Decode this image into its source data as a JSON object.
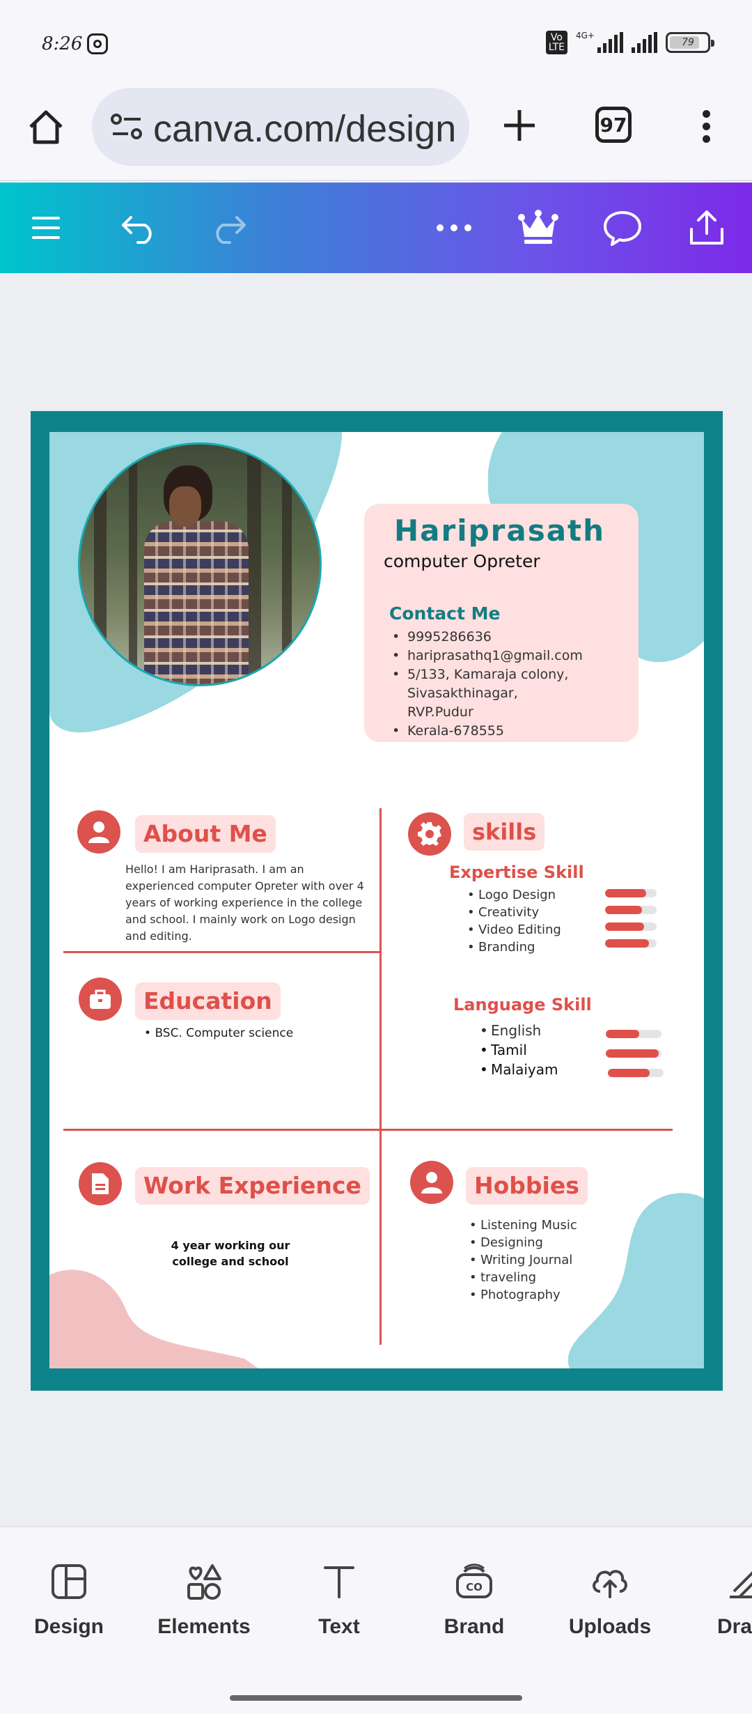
{
  "status_bar": {
    "time": "8:26",
    "volte": "Vo\nLTE",
    "network": "4G+",
    "battery": "79"
  },
  "browser": {
    "url": "canva.com/design",
    "tab_count": "97"
  },
  "resume": {
    "name": "Hariprasath",
    "role": "computer Opreter",
    "contact": {
      "title": "Contact Me",
      "items": [
        "9995286636",
        "hariprasathq1@gmail.com",
        "5/133, Kamaraja colony, Sivasakthinagar, RVP.Pudur",
        "Kerala-678555"
      ]
    },
    "about": {
      "title": "About Me",
      "text": "Hello! I am Hariprasath. I am an experienced computer Opreter with over 4 years of working experience in the college and school. I mainly work on Logo design and editing."
    },
    "education": {
      "title": "Education",
      "items": [
        "BSC. Computer science"
      ]
    },
    "work": {
      "title": "Work Experience",
      "text": "4 year working our college and school"
    },
    "skills": {
      "title": "skills",
      "expertise": {
        "title": "Expertise Skill",
        "items": [
          {
            "name": "Logo Design",
            "level": 0.8
          },
          {
            "name": "Creativity",
            "level": 0.72
          },
          {
            "name": "Video Editing",
            "level": 0.75
          },
          {
            "name": "Branding",
            "level": 0.85
          }
        ]
      },
      "language": {
        "title": "Language Skill",
        "items": [
          {
            "name": "English",
            "level": 0.6
          },
          {
            "name": "Tamil",
            "level": 0.95
          },
          {
            "name": "Malaiyam",
            "level": 0.75
          }
        ]
      }
    },
    "hobbies": {
      "title": "Hobbies",
      "items": [
        "Listening Music",
        "Designing",
        "Writing Journal",
        "traveling",
        "Photography"
      ]
    }
  },
  "bottom_nav": [
    {
      "label": "Design",
      "icon": "design-icon"
    },
    {
      "label": "Elements",
      "icon": "elements-icon"
    },
    {
      "label": "Text",
      "icon": "text-icon"
    },
    {
      "label": "Brand",
      "icon": "brand-icon"
    },
    {
      "label": "Uploads",
      "icon": "uploads-icon"
    },
    {
      "label": "Draw",
      "icon": "draw-icon"
    }
  ],
  "colors": {
    "teal": "#0e838a",
    "accent_red": "#df504a",
    "pink": "#fde0df",
    "blob_blue": "#9ad8e2",
    "blob_pink": "#f1c1c1"
  }
}
